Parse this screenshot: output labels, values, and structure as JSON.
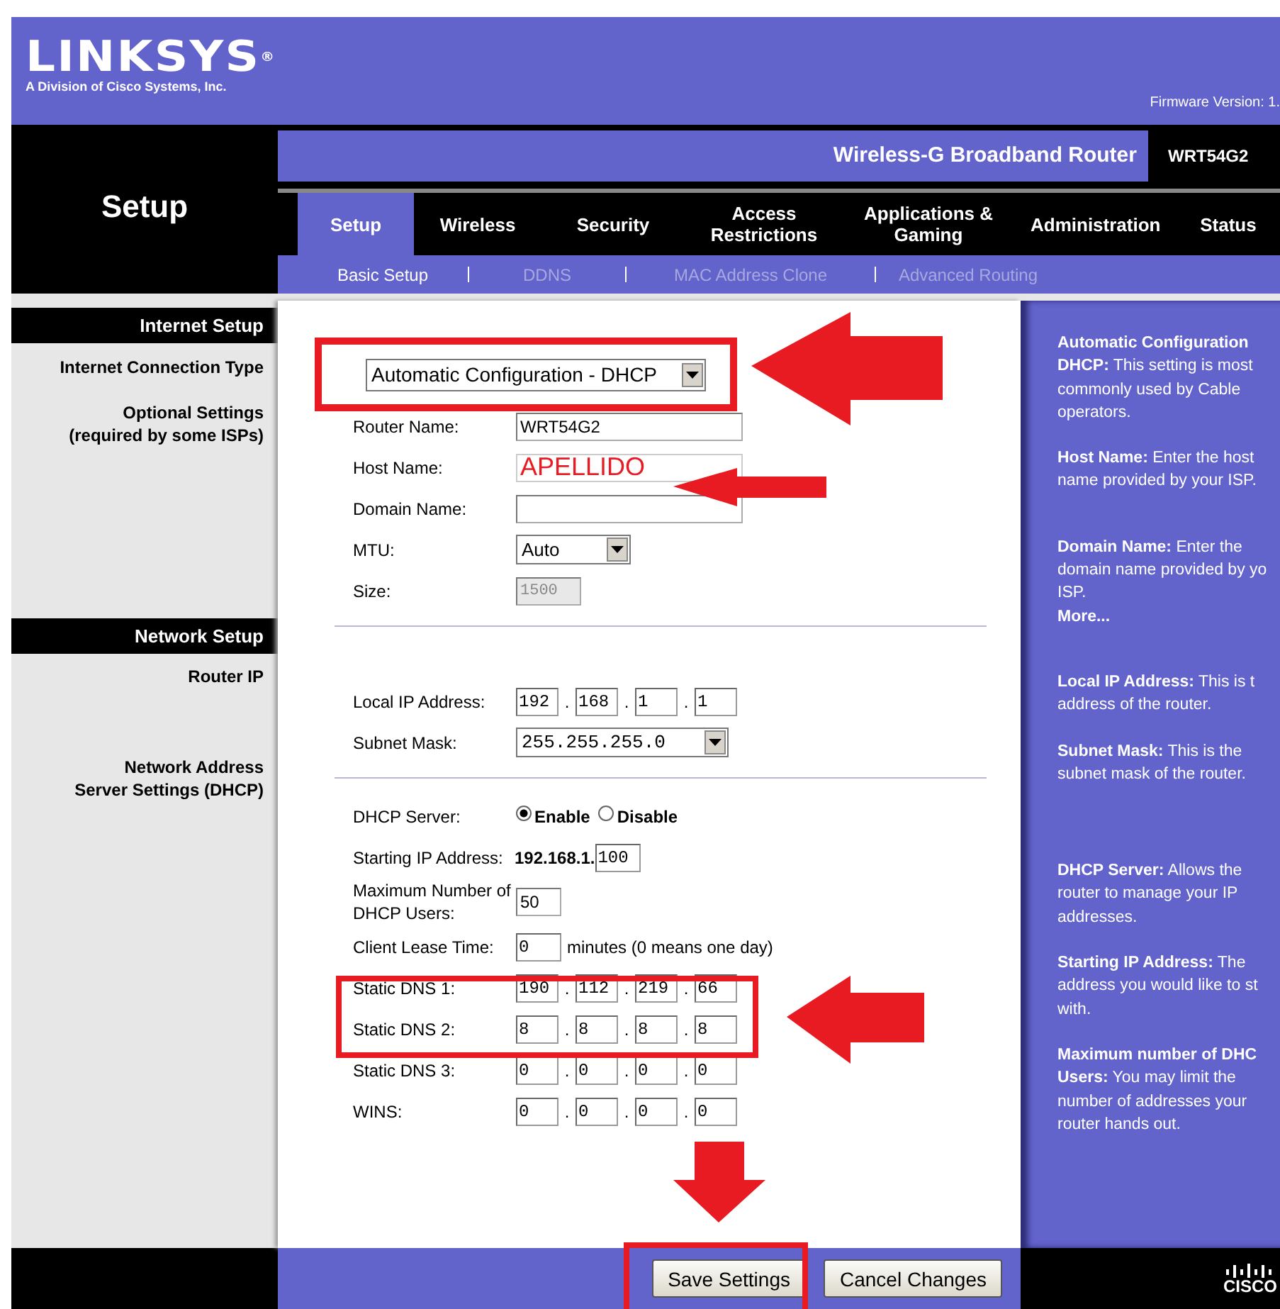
{
  "header": {
    "logo": "LINKSYS$^{®}$",
    "logo_subtitle": "A Division of Cisco Systems, Inc.",
    "firmware": "Firmware Version: 1."
  },
  "page_title": "Setup",
  "product": {
    "name": "Wireless-G Broadband Router",
    "model": "WRT54G2"
  },
  "tabs": [
    {
      "label": "Setup",
      "selected": true
    },
    {
      "label": "Wireless",
      "selected": false
    },
    {
      "label": "Security",
      "selected": false
    },
    {
      "label": "Access Restrictions",
      "selected": false
    },
    {
      "label": "Applications & Gaming",
      "selected": false
    },
    {
      "label": "Administration",
      "selected": false
    },
    {
      "label": "Status",
      "selected": false
    }
  ],
  "subtabs": [
    {
      "label": "Basic Setup",
      "selected": true
    },
    {
      "label": "DDNS",
      "selected": false
    },
    {
      "label": "MAC Address Clone",
      "selected": false
    },
    {
      "label": "Advanced Routing",
      "selected": false
    }
  ],
  "sidebar": [
    {
      "kind": "heading",
      "text": "Internet Setup"
    },
    {
      "kind": "label",
      "lines": [
        "Internet Connection Type"
      ]
    },
    {
      "kind": "label",
      "lines": [
        "Optional Settings",
        "(required by some ISPs)"
      ]
    },
    {
      "kind": "heading",
      "text": "Network Setup"
    },
    {
      "kind": "label",
      "lines": [
        "Router IP"
      ]
    },
    {
      "kind": "label",
      "lines": [
        "Network Address",
        "Server Settings (DHCP)"
      ]
    }
  ],
  "sections": [
    {
      "rows": [
        {
          "kind": "select",
          "value": "Automatic Configuration - DHCP"
        }
      ]
    },
    {
      "rows": [
        {
          "kind": "text",
          "label": "Router Name:",
          "value": "WRT54G2"
        },
        {
          "kind": "text",
          "label": "Host Name:",
          "value": "APELLIDO",
          "annotated": true
        },
        {
          "kind": "text",
          "label": "Domain Name:"
        },
        {
          "kind": "select",
          "label": "MTU:",
          "value": "Auto"
        },
        {
          "kind": "text",
          "label": "Size:",
          "value": "1500",
          "disabled": true
        }
      ]
    },
    {
      "rows": [
        {
          "kind": "ip",
          "label": "Local IP Address:",
          "separator": ".",
          "octets": [
            "192",
            "168",
            "1",
            "1"
          ]
        },
        {
          "kind": "mask_select",
          "label": "Subnet Mask:",
          "value": "255.255.255.0"
        }
      ]
    },
    {
      "rows": [
        {
          "kind": "radio",
          "label": "DHCP Server:",
          "options": [
            {
              "label": "Enable",
              "selected": true
            },
            {
              "label": "Disable",
              "selected": false
            }
          ]
        },
        {
          "kind": "prefix",
          "label": "Starting IP Address:",
          "prefix": "192.168.1.",
          "value": "100"
        },
        {
          "kind": "number",
          "label": "Maximum Number of DHCP Users:",
          "value": "50"
        },
        {
          "kind": "suffix",
          "label": "Client Lease Time:",
          "value": "0",
          "suffix": "minutes (0 means one day)"
        },
        {
          "kind": "ip",
          "label": "Static DNS 1:",
          "separator": ".",
          "octets": [
            "190",
            "112",
            "219",
            "66"
          ]
        },
        {
          "kind": "ip",
          "label": "Static DNS 2:",
          "separator": ".",
          "octets": [
            "8",
            "8",
            "8",
            "8"
          ]
        },
        {
          "kind": "ip",
          "label": "Static DNS 3:",
          "separator": ".",
          "octets": [
            "0",
            "0",
            "0",
            "0"
          ]
        },
        {
          "kind": "ip",
          "label": "WINS:",
          "separator": ".",
          "octets": [
            "0",
            "0",
            "0",
            "0"
          ]
        }
      ]
    }
  ],
  "help": [
    {
      "lines": [
        "**Automatic Configuration**",
        "**DHCP:** This setting is most",
        "commonly used by Cable",
        "operators."
      ]
    },
    {
      "lines": [
        "**Host Name:** Enter the host",
        "name provided by your ISP."
      ]
    },
    {
      "lines": [
        "**Domain Name:** Enter the",
        "domain name provided by yo",
        "ISP.",
        "**More...**"
      ]
    },
    {
      "lines": [
        "**Local IP Address:** This is t",
        "address of the router."
      ]
    },
    {
      "lines": [
        "**Subnet Mask:** This is the",
        "subnet mask of the router."
      ]
    },
    {
      "lines": [
        "**DHCP Server:** Allows the",
        "router to manage your IP",
        "addresses."
      ]
    },
    {
      "lines": [
        "**Starting IP Address:** The",
        "address you would like to st",
        "with."
      ]
    },
    {
      "lines": [
        "**Maximum number of DHC**",
        "**Users:** You may limit the",
        "number of addresses your",
        "router hands out."
      ]
    }
  ],
  "buttons": [
    {
      "label": "Save Settings"
    },
    {
      "label": "Cancel Changes"
    }
  ],
  "footer_logo": "CISCO",
  "annotations": [
    {
      "kind": "box"
    },
    {
      "kind": "left_arrow"
    },
    {
      "kind": "left_arrow"
    },
    {
      "kind": "box"
    },
    {
      "kind": "left_arrow"
    },
    {
      "kind": "down_arrow"
    },
    {
      "kind": "box"
    }
  ]
}
